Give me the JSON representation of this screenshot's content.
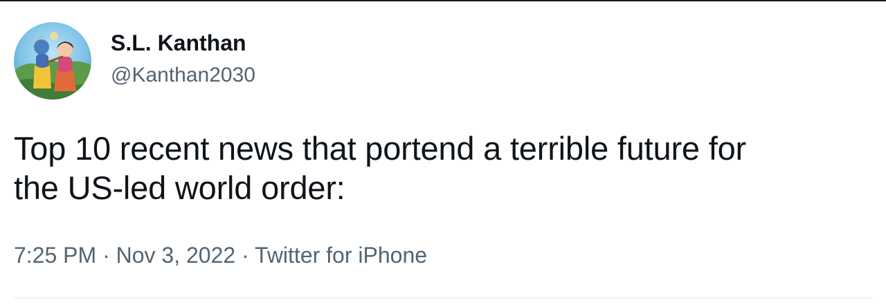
{
  "tweet": {
    "author": {
      "display_name": "S.L. Kanthan",
      "handle": "@Kanthan2030",
      "avatar_icon": "profile-avatar-painting"
    },
    "text_line1": "Top 10 recent news that portend a terrible future for",
    "text_line2": "the US-led world order:",
    "meta": {
      "time": "7:25 PM",
      "separator": "·",
      "date": "Nov 3, 2022",
      "source": "Twitter for iPhone"
    }
  },
  "colors": {
    "text_primary": "#0f1419",
    "text_secondary": "#536471",
    "divider": "#eff3f4",
    "background": "#ffffff"
  }
}
